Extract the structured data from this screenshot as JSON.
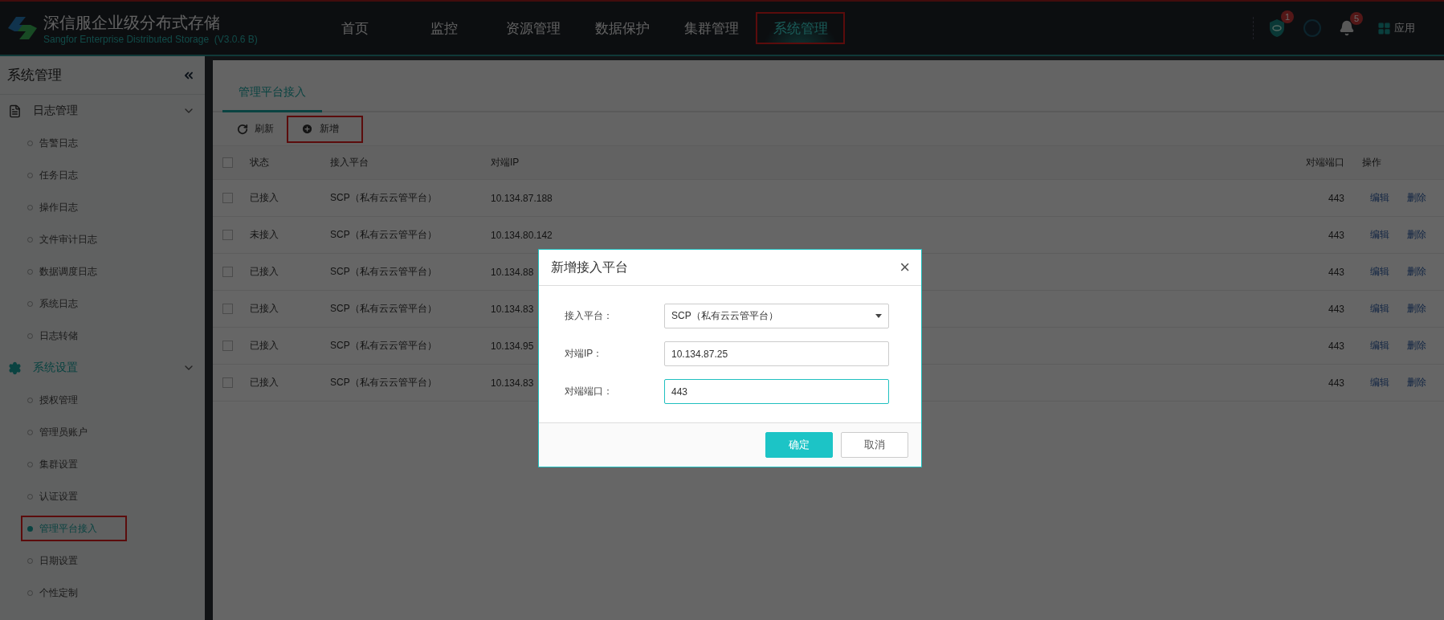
{
  "header": {
    "title": "深信服企业级分布式存储",
    "subtitle": "Sangfor Enterprise Distributed Storage",
    "version": "(V3.0.6 B)",
    "nav": [
      {
        "label": "首页",
        "selected": false,
        "highlighted": false
      },
      {
        "label": "监控",
        "selected": false,
        "highlighted": false
      },
      {
        "label": "资源管理",
        "selected": false,
        "highlighted": false
      },
      {
        "label": "数据保护",
        "selected": false,
        "highlighted": false
      },
      {
        "label": "集群管理",
        "selected": false,
        "highlighted": false
      },
      {
        "label": "系统管理",
        "selected": true,
        "highlighted": true
      }
    ],
    "alerts_count": "1",
    "notifications_count": "5",
    "apps_label": "应用"
  },
  "sidebar": {
    "title": "系统管理",
    "groups": [
      {
        "label": "日志管理",
        "kind": "document",
        "selected": false,
        "expanded": true,
        "items": [
          {
            "label": "告警日志",
            "selected": false,
            "highlighted": false
          },
          {
            "label": "任务日志",
            "selected": false,
            "highlighted": false
          },
          {
            "label": "操作日志",
            "selected": false,
            "highlighted": false
          },
          {
            "label": "文件审计日志",
            "selected": false,
            "highlighted": false
          },
          {
            "label": "数据调度日志",
            "selected": false,
            "highlighted": false
          },
          {
            "label": "系统日志",
            "selected": false,
            "highlighted": false
          },
          {
            "label": "日志转储",
            "selected": false,
            "highlighted": false
          }
        ]
      },
      {
        "label": "系统设置",
        "kind": "settings",
        "selected": true,
        "expanded": true,
        "items": [
          {
            "label": "授权管理",
            "selected": false,
            "highlighted": false
          },
          {
            "label": "管理员账户",
            "selected": false,
            "highlighted": false
          },
          {
            "label": "集群设置",
            "selected": false,
            "highlighted": false
          },
          {
            "label": "认证设置",
            "selected": false,
            "highlighted": false
          },
          {
            "label": "管理平台接入",
            "selected": true,
            "highlighted": true
          },
          {
            "label": "日期设置",
            "selected": false,
            "highlighted": false
          },
          {
            "label": "个性定制",
            "selected": false,
            "highlighted": false
          }
        ]
      }
    ]
  },
  "tabs": [
    {
      "label": "管理平台接入",
      "selected": true
    }
  ],
  "toolbar": [
    {
      "label": "刷新",
      "kind": "refresh",
      "highlighted": false
    },
    {
      "label": "新增",
      "kind": "add",
      "highlighted": true
    }
  ],
  "table": {
    "columns": [
      "状态",
      "接入平台",
      "对端IP",
      "对端端口",
      "操作"
    ],
    "all_checked": false,
    "rows": [
      {
        "checked": false,
        "status": "已接入",
        "platform": "SCP（私有云云管平台）",
        "ip": "10.134.87.188",
        "port": "443",
        "actions": [
          "编辑",
          "删除"
        ]
      },
      {
        "checked": false,
        "status": "未接入",
        "platform": "SCP（私有云云管平台）",
        "ip": "10.134.80.142",
        "port": "443",
        "actions": [
          "编辑",
          "删除"
        ]
      },
      {
        "checked": false,
        "status": "已接入",
        "platform": "SCP（私有云云管平台）",
        "ip": "10.134.88",
        "port": "443",
        "actions": [
          "编辑",
          "删除"
        ]
      },
      {
        "checked": false,
        "status": "已接入",
        "platform": "SCP（私有云云管平台）",
        "ip": "10.134.83",
        "port": "443",
        "actions": [
          "编辑",
          "删除"
        ]
      },
      {
        "checked": false,
        "status": "已接入",
        "platform": "SCP（私有云云管平台）",
        "ip": "10.134.95",
        "port": "443",
        "actions": [
          "编辑",
          "删除"
        ]
      },
      {
        "checked": false,
        "status": "已接入",
        "platform": "SCP（私有云云管平台）",
        "ip": "10.134.83",
        "port": "443",
        "actions": [
          "编辑",
          "删除"
        ]
      }
    ]
  },
  "dialog": {
    "title": "新增接入平台",
    "close": "×",
    "fields": [
      {
        "label": "接入平台：",
        "kind": "select",
        "value": "SCP（私有云云管平台）",
        "focused": false
      },
      {
        "label": "对端IP：",
        "kind": "text",
        "value": "10.134.87.25",
        "focused": false
      },
      {
        "label": "对端端口：",
        "kind": "text",
        "value": "443",
        "focused": true
      }
    ],
    "buttons": [
      {
        "label": "确定",
        "kind": "primary"
      },
      {
        "label": "取消",
        "kind": "secondary"
      }
    ]
  }
}
